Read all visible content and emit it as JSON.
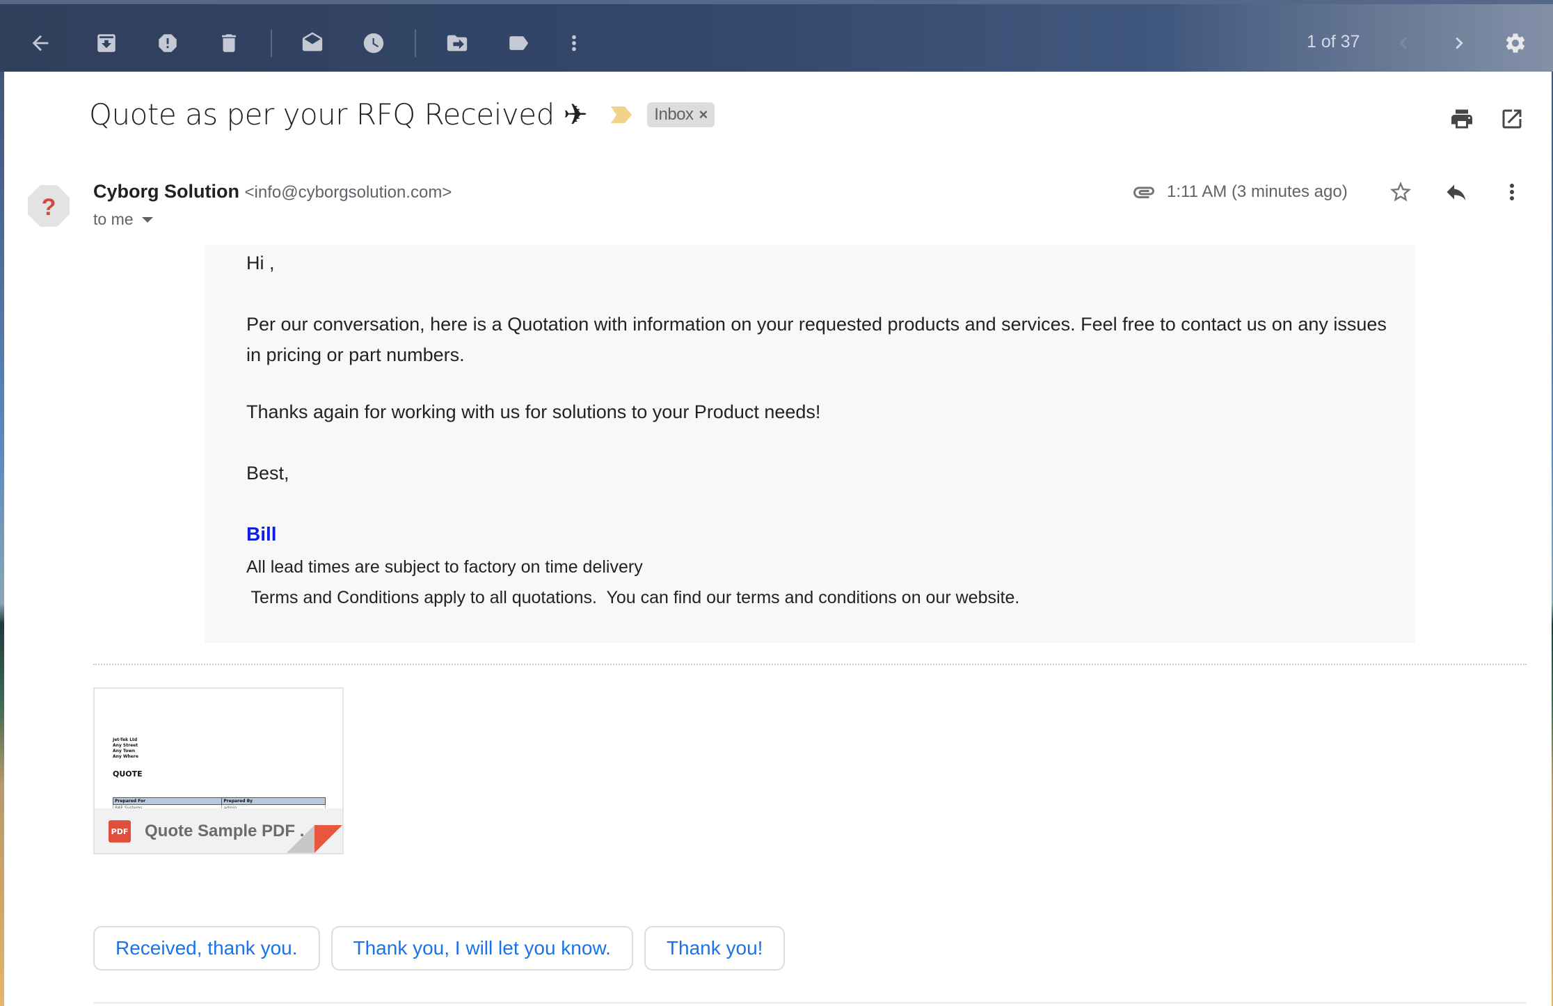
{
  "toolbar": {
    "icons": [
      "back-icon",
      "archive-icon",
      "report-spam-icon",
      "delete-icon",
      "mark-unread-icon",
      "snooze-icon",
      "move-to-icon",
      "label-icon",
      "more-vert-icon"
    ],
    "pager_text": "1 of 37",
    "prev_icon": "chevron-left-icon",
    "next_icon": "chevron-right-icon",
    "settings_icon": "gear-icon"
  },
  "email": {
    "subject": "Quote as per your RFQ Received ✈",
    "importance_marker_color": "#f2d28a",
    "label_chip": "Inbox",
    "label_chip_remove": "×",
    "sender_name": "Cyborg Solution",
    "sender_email": "<info@cyborgsolution.com>",
    "recipient_text": "to me",
    "timestamp": "1:11 AM (3 minutes ago)",
    "avatar_glyph": "?",
    "body": {
      "greeting": "Hi ,",
      "paragraph1": "Per our conversation, here is a Quotation with information on your requested products and services. Feel free to contact us on any issues in pricing or part numbers.",
      "paragraph2": "Thanks again for working with us for solutions to your Product needs!",
      "closing": "Best,",
      "signature_name": "Bill",
      "signature_line1": "All lead times are subject to factory on time delivery",
      "signature_line2": " Terms and Conditions apply to all quotations.  You can find our terms and conditions on our website."
    }
  },
  "attachment": {
    "file_name": "Quote Sample PDF ...",
    "type_badge": "PDF",
    "preview": {
      "address_lines": [
        "Jet-Tek Ltd",
        "Any Street",
        "Any Town",
        "Any Where"
      ],
      "heading": "QUOTE",
      "table_headers": [
        "Prepared For",
        "Prepared By"
      ],
      "table_row": [
        "BAE Systems",
        "admin"
      ]
    }
  },
  "smart_replies": [
    "Received, thank you.",
    "Thank you, I will let you know.",
    "Thank you!"
  ],
  "colors": {
    "link_blue": "#1a73e8",
    "signature_blue": "#0d1ee6",
    "pdf_red": "#e04e3c"
  }
}
